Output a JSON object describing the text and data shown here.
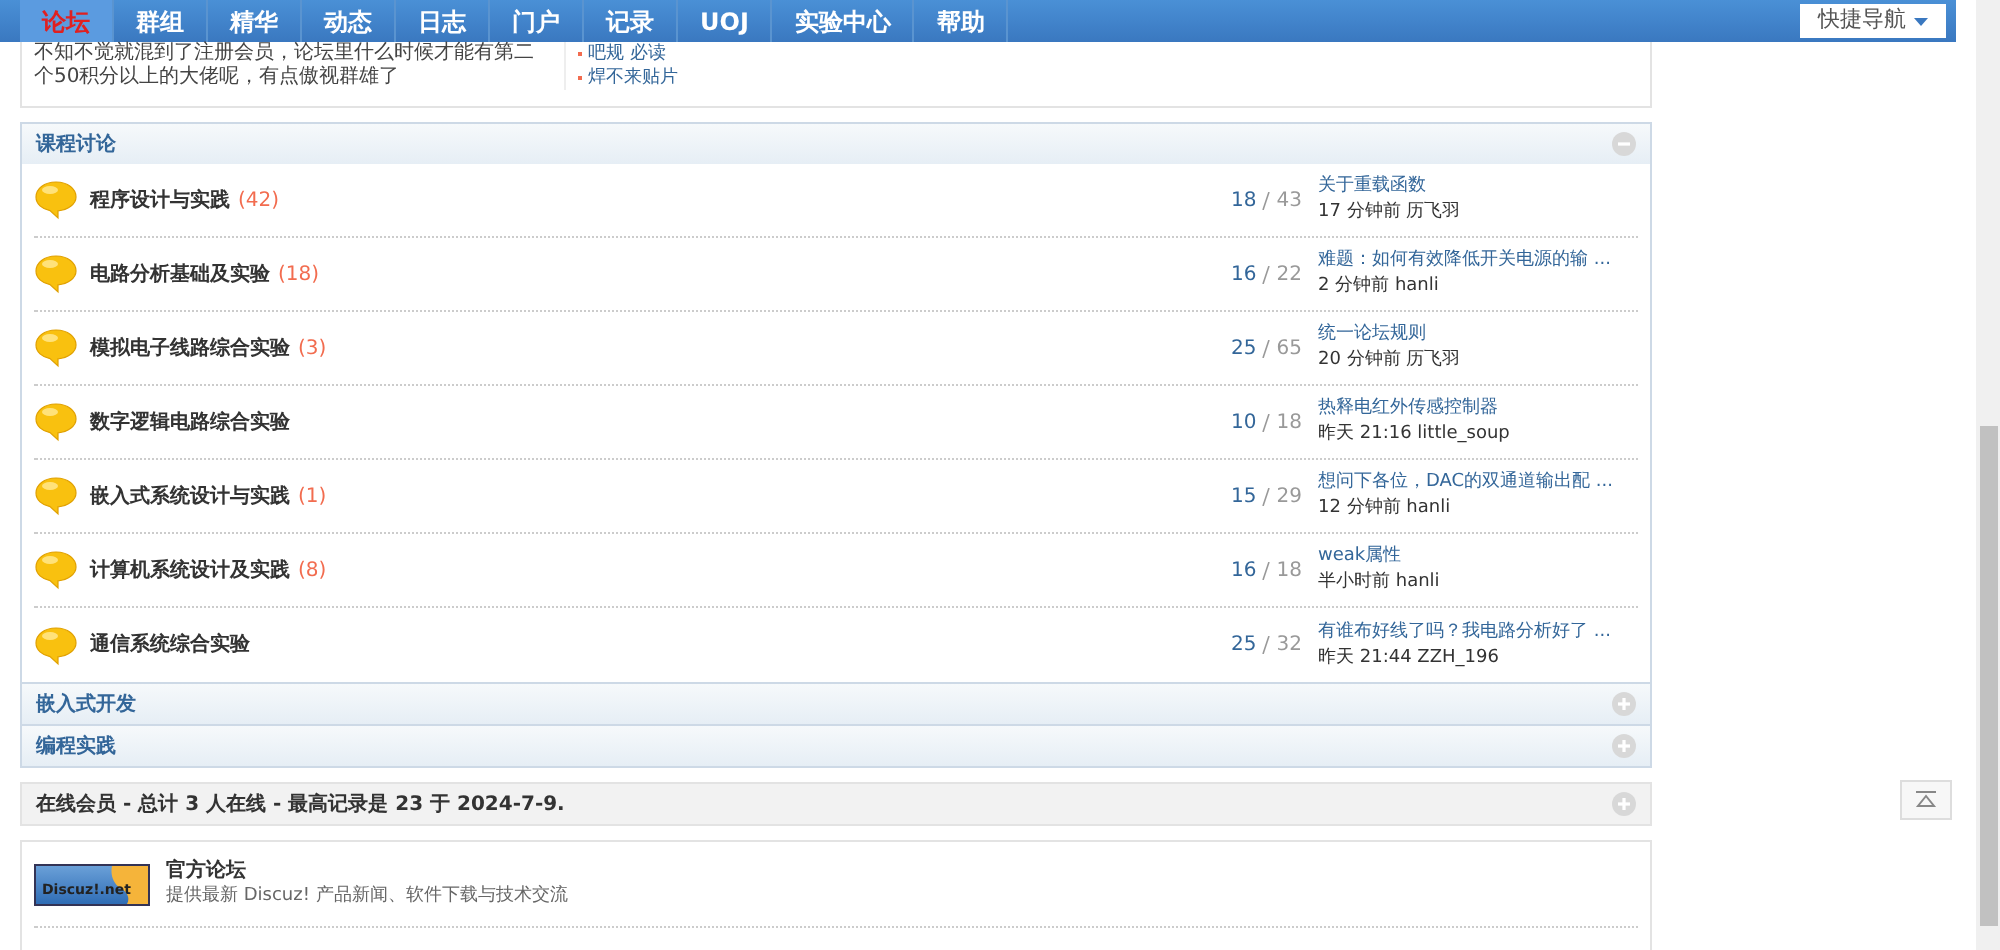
{
  "nav": {
    "items": [
      {
        "label": "论坛",
        "selected": true
      },
      {
        "label": "群组",
        "selected": false
      },
      {
        "label": "精华",
        "selected": false
      },
      {
        "label": "动态",
        "selected": false
      },
      {
        "label": "日志",
        "selected": false
      },
      {
        "label": "门户",
        "selected": false
      },
      {
        "label": "记录",
        "selected": false
      },
      {
        "label": "UOJ",
        "selected": false
      },
      {
        "label": "实验中心",
        "selected": false
      },
      {
        "label": "帮助",
        "selected": false
      }
    ],
    "quick_nav": "快捷导航"
  },
  "intro": {
    "text": "不知不觉就混到了注册会员，论坛里什么时候才能有第二个50积分以上的大佬呢，有点傲视群雄了",
    "links": [
      "吧规 必读",
      "焊不来贴片"
    ]
  },
  "categories": [
    {
      "title": "课程讨论",
      "expanded": true,
      "forums": [
        {
          "name": "程序设计与实践",
          "count": "(42)",
          "threads": "18",
          "posts": "43",
          "last_title": "关于重载函数",
          "last_meta": "17 分钟前 历飞羽"
        },
        {
          "name": "电路分析基础及实验",
          "count": "(18)",
          "threads": "16",
          "posts": "22",
          "last_title": "难题：如何有效降低开关电源的输 ...",
          "last_meta": "2 分钟前 hanli"
        },
        {
          "name": "模拟电子线路综合实验",
          "count": "(3)",
          "threads": "25",
          "posts": "65",
          "last_title": "统一论坛规则",
          "last_meta": "20 分钟前 历飞羽"
        },
        {
          "name": "数字逻辑电路综合实验",
          "threads": "10",
          "posts": "18",
          "last_title": "热释电红外传感控制器",
          "last_meta": "昨天 21:16 little_soup"
        },
        {
          "name": "嵌入式系统设计与实践",
          "count": "(1)",
          "threads": "15",
          "posts": "29",
          "last_title": "想问下各位，DAC的双通道输出配 ...",
          "last_meta": "12 分钟前 hanli"
        },
        {
          "name": "计算机系统设计及实践",
          "count": "(8)",
          "threads": "16",
          "posts": "18",
          "last_title": "weak属性",
          "last_meta": "半小时前 hanli"
        },
        {
          "name": "通信系统综合实验",
          "threads": "25",
          "posts": "32",
          "last_title": "有谁布好线了吗？我电路分析好了 ...",
          "last_meta": "昨天 21:44 ZZH_196"
        }
      ]
    },
    {
      "title": "嵌入式开发",
      "expanded": false
    },
    {
      "title": "编程实践",
      "expanded": false
    }
  ],
  "online": {
    "text": "在线会员 - 总计 3 人在线 - 最高记录是 23 于 2024-7-9.",
    "expanded": false
  },
  "links_card": {
    "logo_text": "Discuz!.net",
    "title": "官方论坛",
    "description": "提供最新 Discuz! 产品新闻、软件下载与技术交流"
  }
}
